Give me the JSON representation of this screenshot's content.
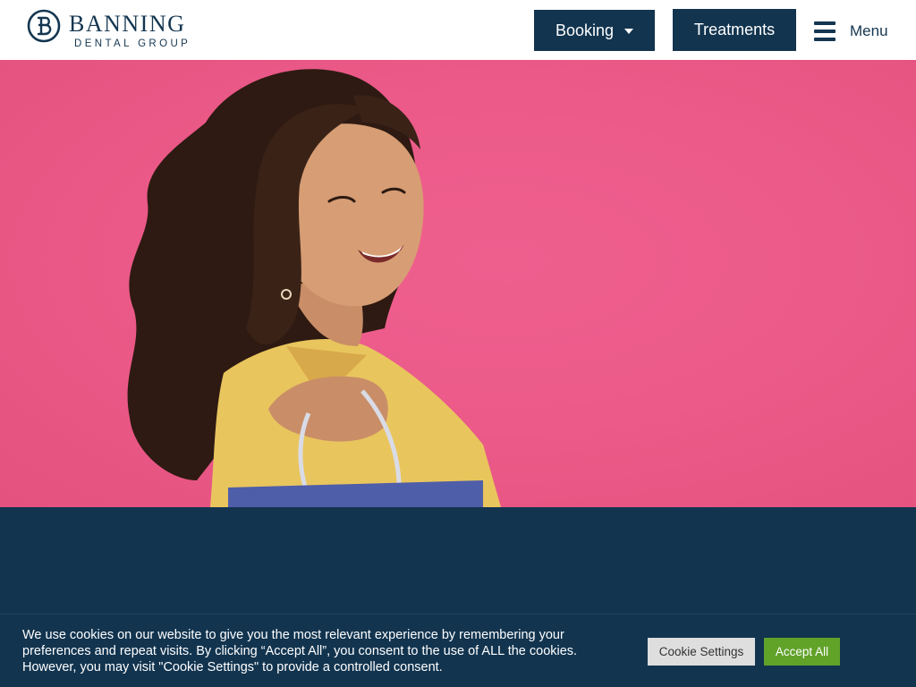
{
  "header": {
    "logo": {
      "name": "BANNING",
      "subtitle": "DENTAL GROUP"
    },
    "booking_label": "Booking",
    "treatments_label": "Treatments",
    "menu_label": "Menu"
  },
  "hero": {
    "image_alt": ""
  },
  "cookie_banner": {
    "message": "We use cookies on our website to give you the most relevant experience by remembering your preferences and repeat visits. By clicking “Accept All”, you consent to the use of ALL the cookies. However, you may visit \"Cookie Settings\" to provide a controlled consent.",
    "settings_label": "Cookie Settings",
    "accept_label": "Accept All"
  },
  "colors": {
    "navy": "#12344f",
    "hero_pink": "#ec5b8a",
    "accept_green": "#61a229",
    "settings_gray": "#dedede"
  },
  "icons": [
    "logo-mark-icon",
    "chevron-down-icon",
    "hamburger-icon"
  ]
}
